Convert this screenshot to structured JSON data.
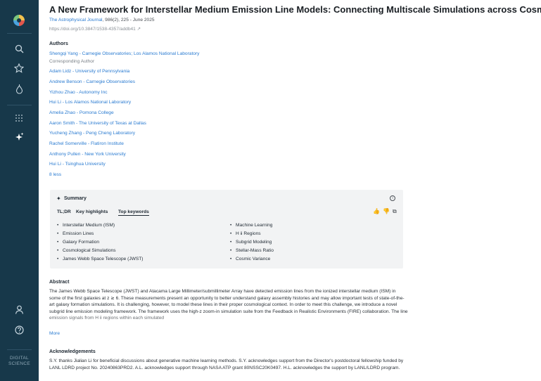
{
  "sidebar": {
    "icons": [
      "logo-icon",
      "search-icon",
      "star-icon",
      "sparkle-drop-icon",
      "grid-icon",
      "ai-sparkle-icon",
      "user-icon",
      "help-icon"
    ],
    "brand_line1": "DIGITAL",
    "brand_line2": "SCIENCE"
  },
  "article": {
    "title": "A New Framework for Interstellar Medium Emission Line Models: Connecting Multiscale Simulations across Cosmological Volumes",
    "journal_name": "The Astrophysical Journal",
    "journal_rest": ", 986(2), 225 - June 2025",
    "doi": "https://doi.org/10.3847/1538-4357/addb41",
    "doi_icon": "↗"
  },
  "authors": {
    "heading": "Authors",
    "list": [
      "Shengqi Yang - Carnegie Observatories; Los Alamos National Laboratory",
      "Adam Lidz - University of Pennsylvania",
      "Andrew Benson - Carnegie Observatories",
      "Yizhou Zhao - Autonomy Inc",
      "Hui Li - Los Alamos National Laboratory",
      "Amelia Zhao - Pomona College",
      "Aaron Smith - The University of Texas at Dallas",
      "Yucheng Zhang - Peng Cheng Laboratory",
      "Rachel Somerville - Flatiron Institute",
      "Anthony Pullen - New York University",
      "Hui Li - Tsinghua University"
    ],
    "corresponding": "Corresponding Author",
    "less_link": "8 less"
  },
  "summary": {
    "spark": "✦",
    "title": "Summary",
    "info": "i",
    "tabs": [
      "TL;DR",
      "Key highlights",
      "Top keywords"
    ],
    "actions": [
      "👍",
      "👎",
      "⧉"
    ],
    "keywords_left": [
      "Interstellar Medium (ISM)",
      "Emission Lines",
      "Galaxy Formation",
      "Cosmological Simulations",
      "James Webb Space Telescope (JWST)"
    ],
    "keywords_right": [
      "Machine Learning",
      "H ii Regions",
      "Subgrid Modeling",
      "Stellar-Mass Ratio",
      "Cosmic Variance"
    ]
  },
  "abstract": {
    "heading": "Abstract",
    "text": "The James Webb Space Telescope (JWST) and Atacama Large Millimeter/submillimeter Array have detected emission lines from the ionized interstellar medium (ISM) in some of the first galaxies at z ≳ 6. These measurements present an opportunity to better understand galaxy assembly histories and may allow important tests of state-of-the-art galaxy formation simulations. It is challenging, however, to model these lines in their proper cosmological context. In order to meet this challenge, we introduce a novel subgrid line emission modeling framework. The framework uses the high-z zoom-in simulation suite from the Feedback in Realistic Environments (FIRE) collaboration. The line emission signals from H ii regions within each simulated",
    "more": "More"
  },
  "acknowledgements": {
    "heading": "Acknowledgements",
    "text": "S.Y. thanks Jialian Li for beneficial discussions about generative machine learning methods. S.Y. acknowledges support from the Director's postdoctoral fellowship funded by LANL LDRD project No. 20240863PRD2. A.L. acknowledges support through NASA ATP grant 80NSSC20K0497. H.L. acknowledges the support by LANL/LDRD program."
  }
}
